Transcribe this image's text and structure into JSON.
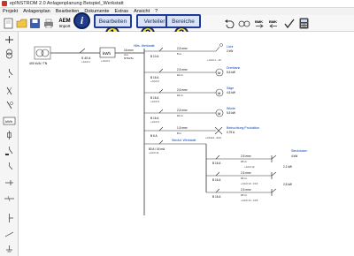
{
  "window": {
    "title": "epINSTROM 2.0 Anlagenplanung   Beispiel_Werkstatt"
  },
  "menu": [
    "Projekt",
    "Anlagenplan",
    "Bearbeiten",
    "Dokumente",
    "Extras",
    "Ansicht",
    "?"
  ],
  "toolbar": {
    "aem_label": "AEM",
    "import_label": "Import",
    "bmk_label": "BMK",
    "info_glyph": "i",
    "tabs": [
      {
        "label": "Bearbeiten",
        "number": "1"
      },
      {
        "label": "Verteiler",
        "number": "2"
      },
      {
        "label": "Bereiche",
        "number": "3"
      }
    ]
  },
  "schematic": {
    "transformer": "400 kVA / TN",
    "main_fuse": "S 40 A",
    "main_id": "+A0-F1",
    "meter": "kWh",
    "meter_id": "+A0-P1",
    "feeder": "Hilfs. Werkstatt",
    "feeder_cable": "16 mm²",
    "feeder_len": "4 m",
    "feeder_type": "NYM-5x",
    "branches": [
      {
        "label": "Licht",
        "load": "2 kW",
        "fuse": "B 10 A",
        "cable": "2,5 mm²",
        "len": "5 m",
        "id": "+A0-F1...10"
      },
      {
        "label": "Drehbank",
        "load": "5,6 kW",
        "fuse": "B 16 A",
        "cable": "2,5 mm²",
        "len": "10 m",
        "id": "+A0-F2"
      },
      {
        "label": "Säge",
        "load": "4,5 kW",
        "fuse": "B 16 A",
        "cable": "2,5 mm²",
        "len": "10 m",
        "id": "+A0-F3"
      },
      {
        "label": "Winde",
        "load": "5,5 kW",
        "fuse": "B 16 A",
        "cable": "2,5 mm²",
        "len": "10 m",
        "id": "+A0-F4"
      },
      {
        "label": "Beleuchtung Produktion",
        "load": "0,75 A",
        "fuse": "B 6 A",
        "cable": "1,5 mm²",
        "len": "8 m",
        "id": "+A0-E4...E12"
      }
    ],
    "sub_feeder": "Steckd. Werkstatt",
    "sub_fuse": "80 A / 16 mA",
    "sub_id": "+A0-F11",
    "sub_branches": [
      {
        "label": "Steckdosen",
        "load": "4 kW",
        "fuse": "B 16 A",
        "cable": "2,5 mm²",
        "len": "15 m",
        "id": "+A0-F12"
      },
      {
        "label": "",
        "load": "2,1 kW",
        "fuse": "B 16 A",
        "cable": "2,5 mm²",
        "len": "15 m",
        "id": "+A0-F13...F16"
      },
      {
        "label": "",
        "load": "2,5 kW",
        "fuse": "B 16 A",
        "cable": "2,5 mm²",
        "len": "15 m",
        "id": "+A0-F14...F18"
      }
    ]
  }
}
